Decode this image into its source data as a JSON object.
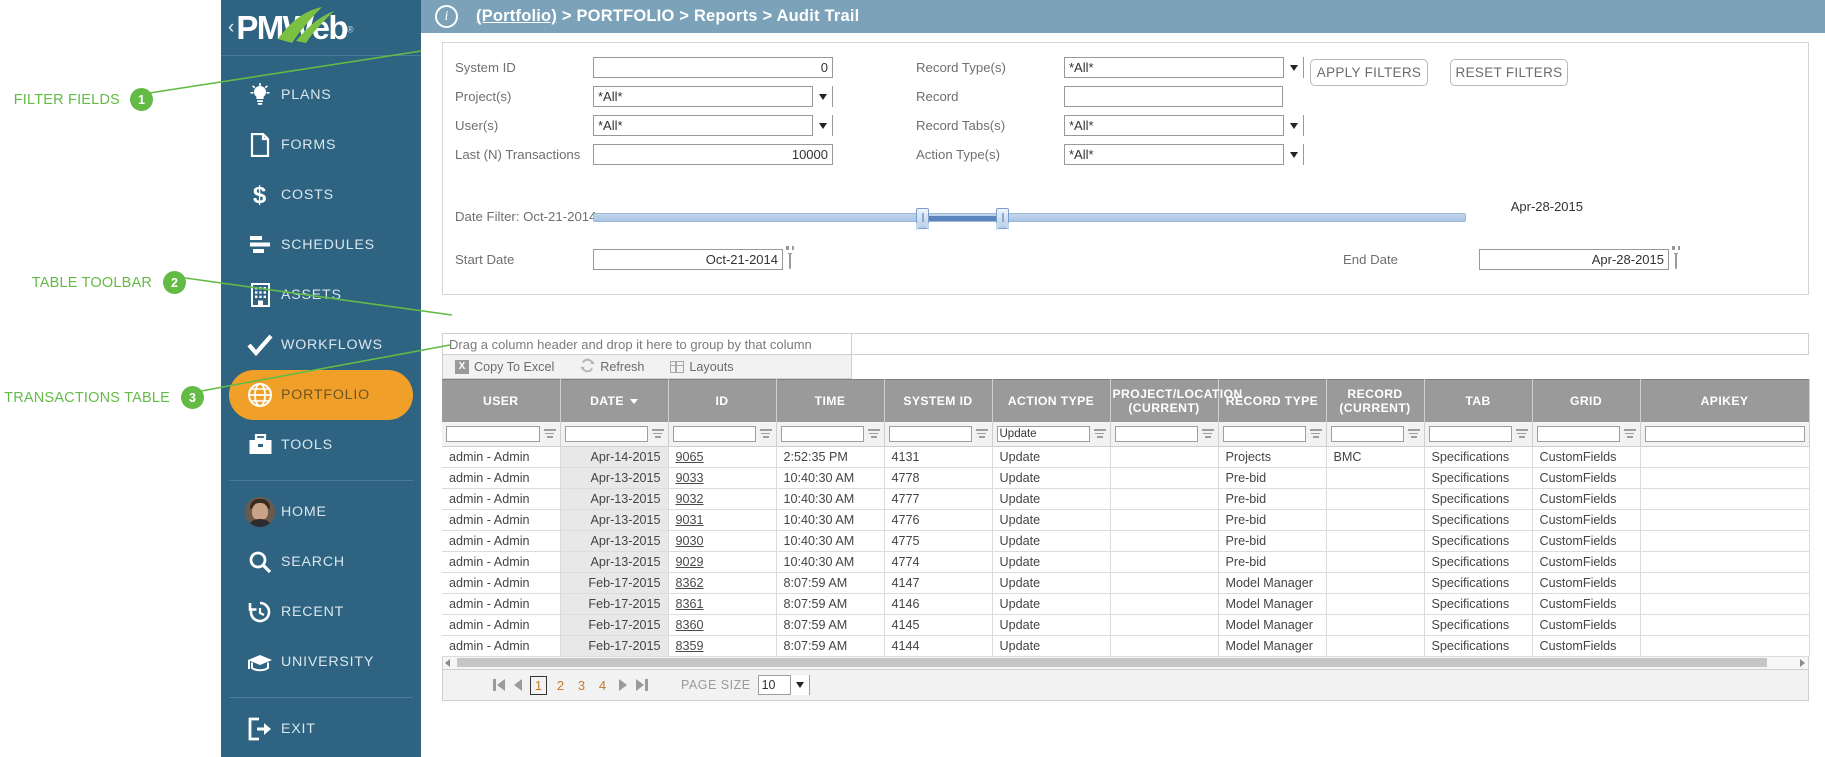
{
  "annotations": [
    {
      "label": "FILTER FIELDS",
      "number": "1"
    },
    {
      "label": "TABLE TOOLBAR",
      "number": "2"
    },
    {
      "label": "TRANSACTIONS TABLE",
      "number": "3"
    }
  ],
  "brand": {
    "name": "PMWeb",
    "trademark": "®",
    "collapse_caret": "‹"
  },
  "sidebar": {
    "items": [
      {
        "label": "PLANS",
        "icon": "lightbulb-icon",
        "active": false
      },
      {
        "label": "FORMS",
        "icon": "document-icon",
        "active": false
      },
      {
        "label": "COSTS",
        "icon": "dollar-icon",
        "active": false
      },
      {
        "label": "SCHEDULES",
        "icon": "gantt-icon",
        "active": false
      },
      {
        "label": "ASSETS",
        "icon": "building-icon",
        "active": false
      },
      {
        "label": "WORKFLOWS",
        "icon": "check-icon",
        "active": false
      },
      {
        "label": "PORTFOLIO",
        "icon": "globe-icon",
        "active": true
      },
      {
        "label": "TOOLS",
        "icon": "briefcase-icon",
        "active": false
      }
    ],
    "user_items": [
      {
        "label": "HOME",
        "icon": "avatar-icon"
      },
      {
        "label": "SEARCH",
        "icon": "search-icon"
      },
      {
        "label": "RECENT",
        "icon": "history-icon"
      },
      {
        "label": "UNIVERSITY",
        "icon": "graduation-cap-icon"
      }
    ],
    "exit": {
      "label": "EXIT",
      "icon": "exit-icon"
    }
  },
  "topbar": {
    "info_icon": "info-icon",
    "breadcrumb": {
      "root": "(Portfolio)",
      "sep": ">",
      "items": [
        "PORTFOLIO",
        "Reports",
        "Audit Trail"
      ]
    }
  },
  "filters": {
    "left": [
      {
        "label": "System ID",
        "type": "text",
        "value": "0",
        "align": "right"
      },
      {
        "label": "Project(s)",
        "type": "select",
        "value": "*All*"
      },
      {
        "label": "User(s)",
        "type": "select",
        "value": "*All*"
      },
      {
        "label": "Last (N) Transactions",
        "type": "text",
        "value": "10000",
        "align": "right"
      }
    ],
    "right": [
      {
        "label": "Record Type(s)",
        "type": "select",
        "value": "*All*"
      },
      {
        "label": "Record",
        "type": "text",
        "value": ""
      },
      {
        "label": "Record Tabs(s)",
        "type": "select",
        "value": "*All*"
      },
      {
        "label": "Action Type(s)",
        "type": "select",
        "value": "*All*"
      }
    ],
    "apply_label": "APPLY FILTERS",
    "reset_label": "RESET FILTERS",
    "date_filter_label": "Date Filter: Oct-21-2014",
    "date_range_end_label": "Apr-28-2015",
    "start_date_label": "Start Date",
    "start_date_value": "Oct-21-2014",
    "end_date_label": "End Date",
    "end_date_value": "Apr-28-2015"
  },
  "grid": {
    "group_hint": "Drag a column header and drop it here to group by that column",
    "toolbar": [
      {
        "label": "Copy To Excel",
        "icon": "excel-icon"
      },
      {
        "label": "Refresh",
        "icon": "refresh-icon"
      },
      {
        "label": "Layouts",
        "icon": "layouts-icon"
      }
    ],
    "columns": [
      {
        "key": "user",
        "label": "USER",
        "sorted": false
      },
      {
        "key": "date",
        "label": "DATE",
        "sorted": true
      },
      {
        "key": "id",
        "label": "ID",
        "sorted": false
      },
      {
        "key": "time",
        "label": "TIME",
        "sorted": false
      },
      {
        "key": "system_id",
        "label": "SYSTEM ID",
        "sorted": false
      },
      {
        "key": "action_type",
        "label": "ACTION TYPE",
        "sorted": false
      },
      {
        "key": "project_location",
        "label": "PROJECT/LOCATION\n(CURRENT)",
        "sorted": false
      },
      {
        "key": "record_type",
        "label": "RECORD TYPE",
        "sorted": false
      },
      {
        "key": "record_current",
        "label": "RECORD\n(CURRENT)",
        "sorted": false
      },
      {
        "key": "tab",
        "label": "TAB",
        "sorted": false
      },
      {
        "key": "grid",
        "label": "GRID",
        "sorted": false
      },
      {
        "key": "apikey",
        "label": "APIKEY",
        "sorted": false
      }
    ],
    "column_filters": {
      "user": "",
      "date": "",
      "id": "",
      "time": "",
      "system_id": "",
      "action_type": "Update",
      "project_location": "",
      "record_type": "",
      "record_current": "",
      "tab": "",
      "grid": "",
      "apikey": ""
    },
    "rows": [
      {
        "user": "admin - Admin",
        "date": "Apr-14-2015",
        "id": "9065",
        "time": "2:52:35 PM",
        "system_id": "4131",
        "action_type": "Update",
        "project_location": "",
        "record_type": "Projects",
        "record_current": "BMC",
        "tab": "Specifications",
        "grid": "CustomFields",
        "apikey": ""
      },
      {
        "user": "admin - Admin",
        "date": "Apr-13-2015",
        "id": "9033",
        "time": "10:40:30 AM",
        "system_id": "4778",
        "action_type": "Update",
        "project_location": "",
        "record_type": "Pre-bid",
        "record_current": "",
        "tab": "Specifications",
        "grid": "CustomFields",
        "apikey": ""
      },
      {
        "user": "admin - Admin",
        "date": "Apr-13-2015",
        "id": "9032",
        "time": "10:40:30 AM",
        "system_id": "4777",
        "action_type": "Update",
        "project_location": "",
        "record_type": "Pre-bid",
        "record_current": "",
        "tab": "Specifications",
        "grid": "CustomFields",
        "apikey": ""
      },
      {
        "user": "admin - Admin",
        "date": "Apr-13-2015",
        "id": "9031",
        "time": "10:40:30 AM",
        "system_id": "4776",
        "action_type": "Update",
        "project_location": "",
        "record_type": "Pre-bid",
        "record_current": "",
        "tab": "Specifications",
        "grid": "CustomFields",
        "apikey": ""
      },
      {
        "user": "admin - Admin",
        "date": "Apr-13-2015",
        "id": "9030",
        "time": "10:40:30 AM",
        "system_id": "4775",
        "action_type": "Update",
        "project_location": "",
        "record_type": "Pre-bid",
        "record_current": "",
        "tab": "Specifications",
        "grid": "CustomFields",
        "apikey": ""
      },
      {
        "user": "admin - Admin",
        "date": "Apr-13-2015",
        "id": "9029",
        "time": "10:40:30 AM",
        "system_id": "4774",
        "action_type": "Update",
        "project_location": "",
        "record_type": "Pre-bid",
        "record_current": "",
        "tab": "Specifications",
        "grid": "CustomFields",
        "apikey": ""
      },
      {
        "user": "admin - Admin",
        "date": "Feb-17-2015",
        "id": "8362",
        "time": "8:07:59 AM",
        "system_id": "4147",
        "action_type": "Update",
        "project_location": "",
        "record_type": "Model Manager",
        "record_current": "",
        "tab": "Specifications",
        "grid": "CustomFields",
        "apikey": ""
      },
      {
        "user": "admin - Admin",
        "date": "Feb-17-2015",
        "id": "8361",
        "time": "8:07:59 AM",
        "system_id": "4146",
        "action_type": "Update",
        "project_location": "",
        "record_type": "Model Manager",
        "record_current": "",
        "tab": "Specifications",
        "grid": "CustomFields",
        "apikey": ""
      },
      {
        "user": "admin - Admin",
        "date": "Feb-17-2015",
        "id": "8360",
        "time": "8:07:59 AM",
        "system_id": "4145",
        "action_type": "Update",
        "project_location": "",
        "record_type": "Model Manager",
        "record_current": "",
        "tab": "Specifications",
        "grid": "CustomFields",
        "apikey": ""
      },
      {
        "user": "admin - Admin",
        "date": "Feb-17-2015",
        "id": "8359",
        "time": "8:07:59 AM",
        "system_id": "4144",
        "action_type": "Update",
        "project_location": "",
        "record_type": "Model Manager",
        "record_current": "",
        "tab": "Specifications",
        "grid": "CustomFields",
        "apikey": ""
      }
    ],
    "pager": {
      "first": "⏮",
      "prev": "◀",
      "next": "▶",
      "last": "⏭",
      "pages": [
        "1",
        "2",
        "3",
        "4"
      ],
      "current_page": "1",
      "page_size_label": "PAGE SIZE",
      "page_size_value": "10"
    }
  },
  "colors": {
    "sidebar": "#2e6381",
    "topbar": "#7ba2b8",
    "active_nav": "#f0a028",
    "annotation": "#63bb46",
    "header_gray": "#9a9a9a",
    "link": "#c47a2a"
  }
}
